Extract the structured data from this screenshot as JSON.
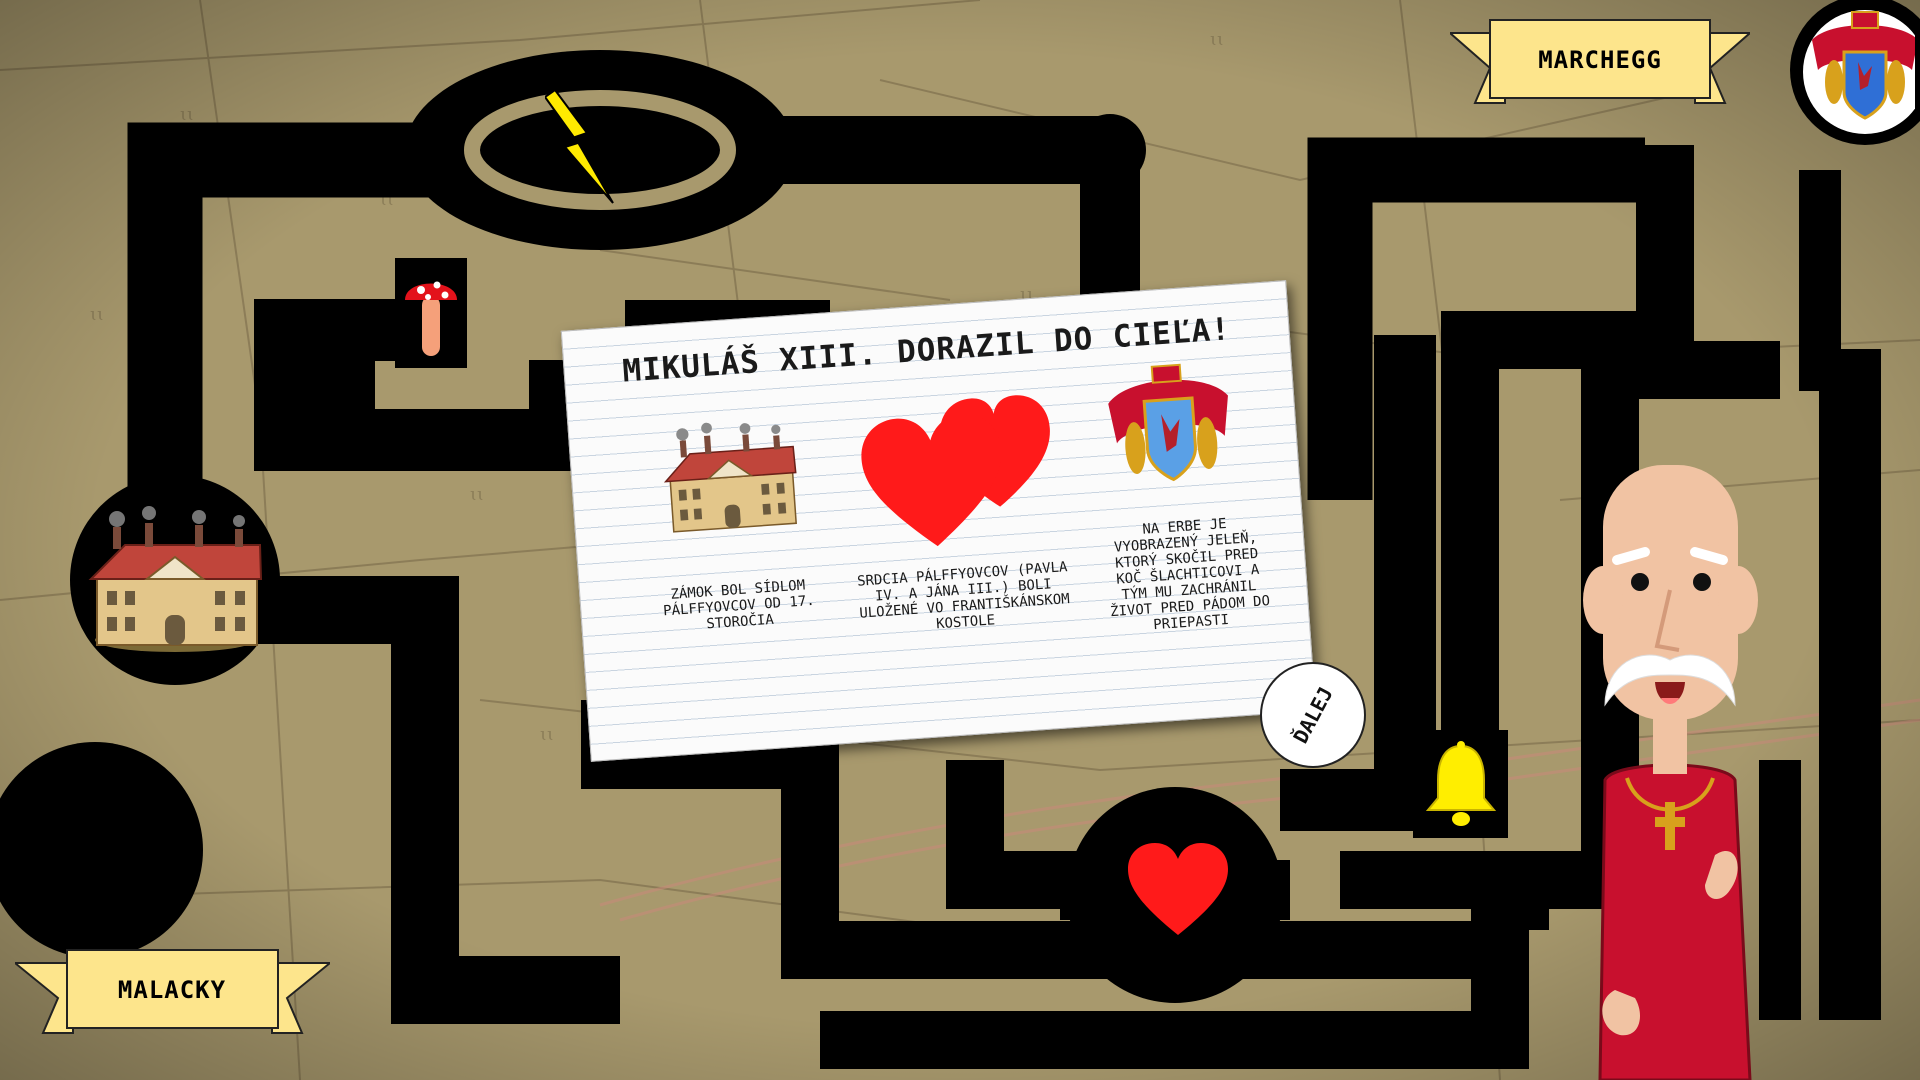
{
  "locations": {
    "start": "MALACKY",
    "destination": "MARCHEGG"
  },
  "card": {
    "title": "MIKULÁŠ XIII. DORAZIL DO CIEĽA!",
    "items": [
      {
        "icon": "castle-icon",
        "caption": "ZÁMOK BOL SÍDLOM PÁLFFYOVCOV OD 17. STOROČIA"
      },
      {
        "icon": "two-hearts-icon",
        "caption": "SRDCIA PÁLFFYOVCOV (PAVLA IV. A JÁNA III.) BOLI ULOŽENÉ VO FRANTIŠKÁNSKOM KOSTOLE"
      },
      {
        "icon": "coat-of-arms-icon",
        "caption": "NA ERBE JE VYOBRAZENÝ JELEŇ, KTORÝ SKOČIL PRED KOČ ŠLACHTICOVI A TÝM MU ZACHRÁNIL ŽIVOT PRED PÁDOM DO PRIEPASTI"
      }
    ]
  },
  "next_button": "ĎALEJ",
  "map_icons": [
    "lightning-icon",
    "mushroom-icon",
    "castle-icon",
    "heart-icon",
    "bell-icon",
    "coat-of-arms-icon"
  ],
  "colors": {
    "path": "#000000",
    "banner": "#fde58c",
    "heart": "#ff1a1a",
    "bell": "#ffee00",
    "robe": "#c8102e"
  }
}
